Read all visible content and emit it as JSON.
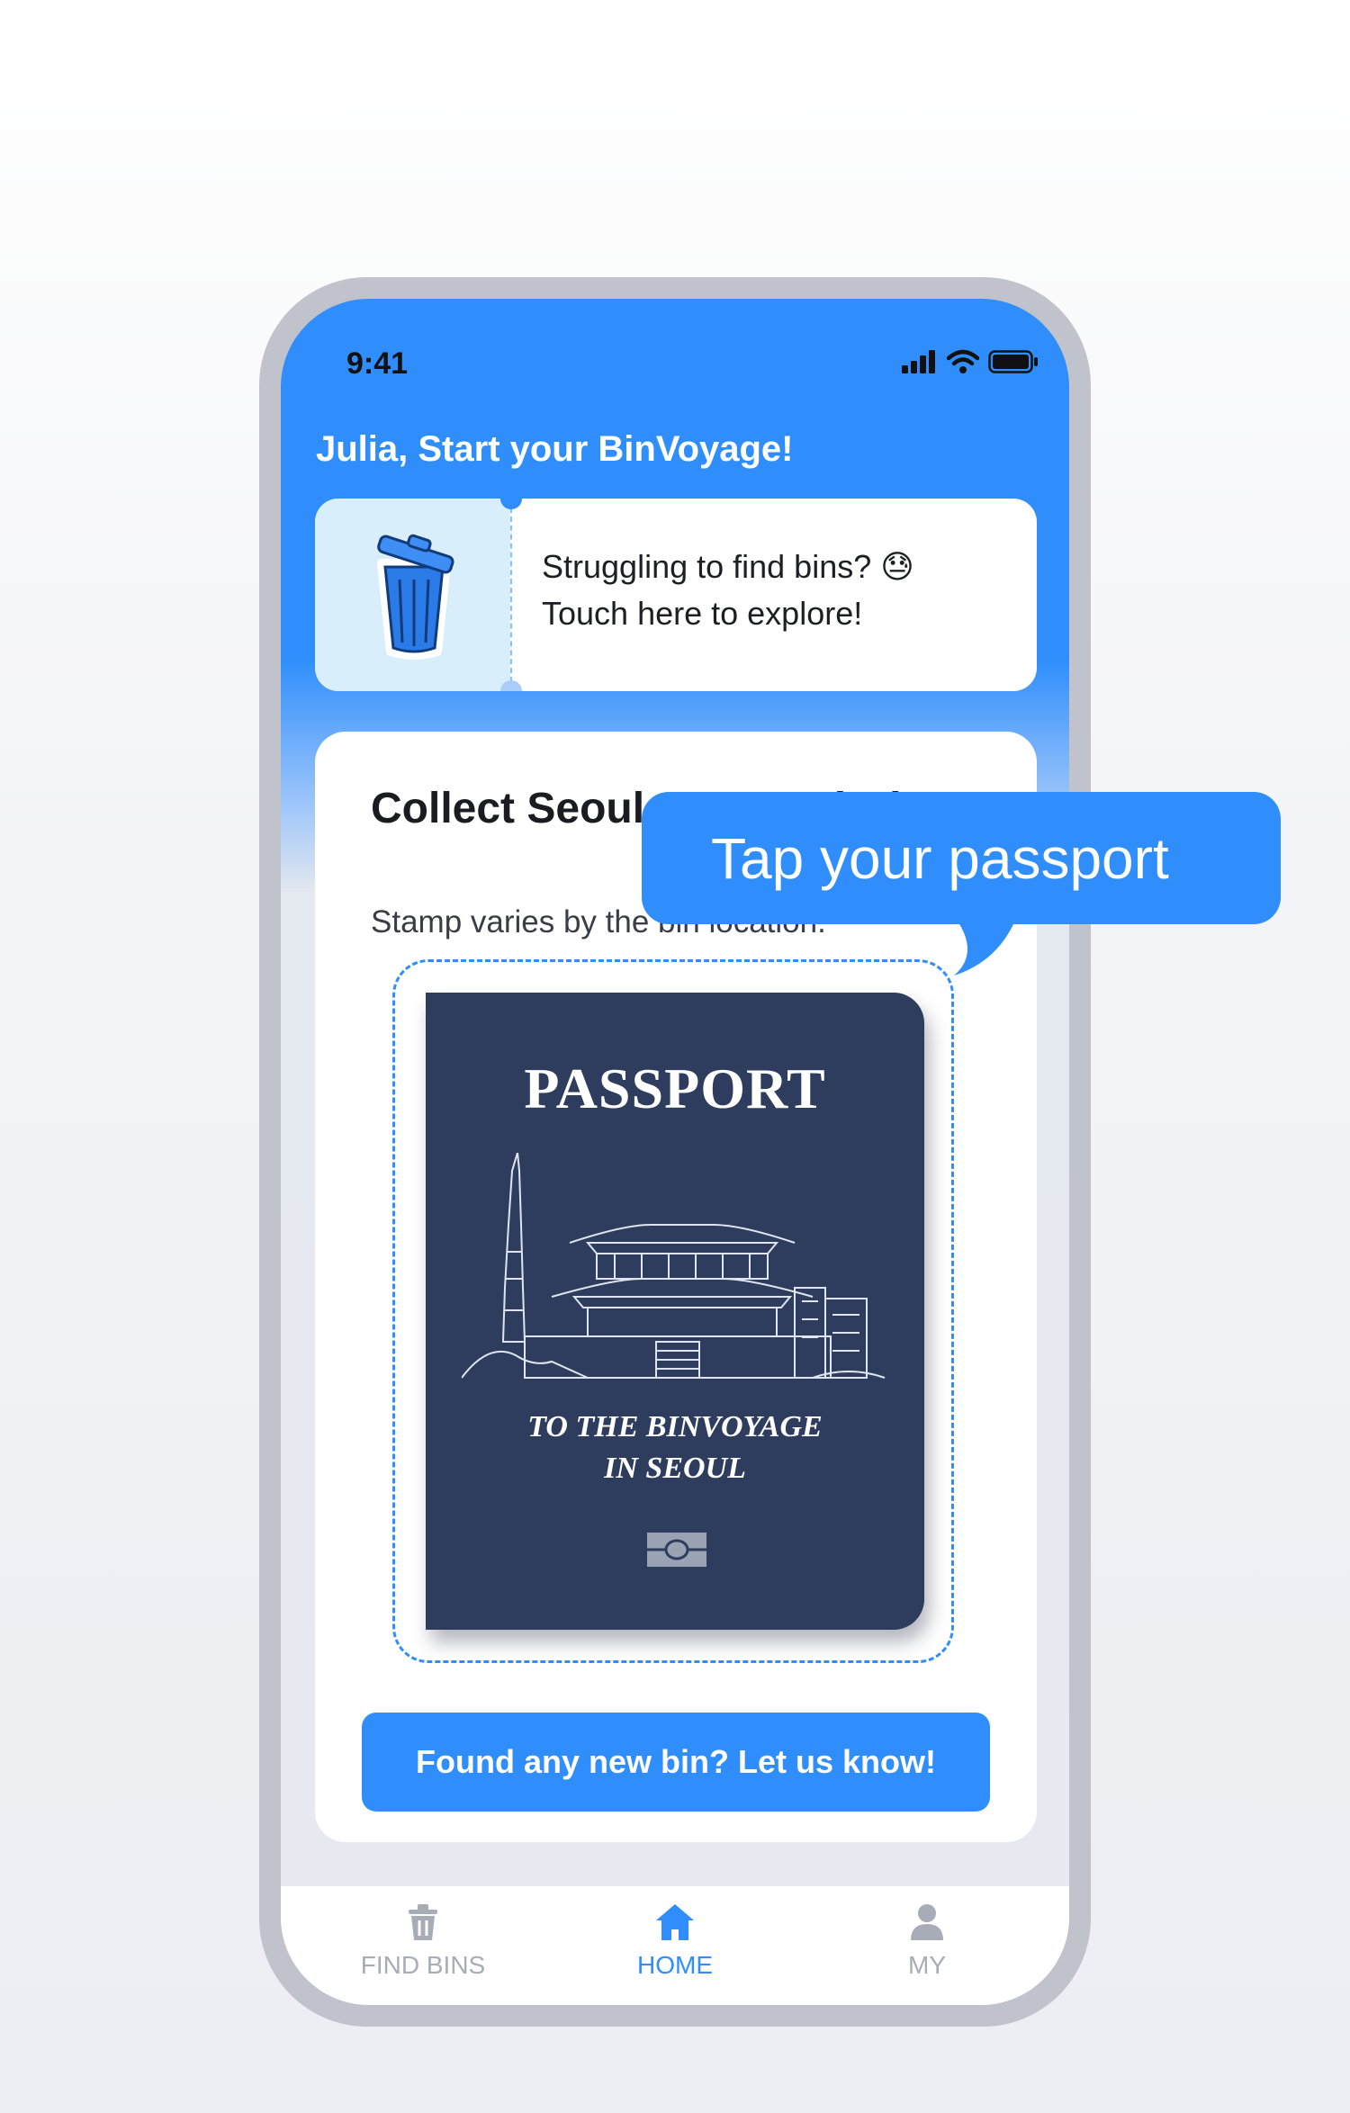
{
  "status_bar": {
    "time": "9:41"
  },
  "header": {
    "greeting": "Julia, Start your BinVoyage!"
  },
  "bins_card": {
    "line1": "Struggling to find bins? 😓",
    "line2": "Touch here to explore!",
    "icon": "trash-bin-icon"
  },
  "main_card": {
    "title": "Collect Seoul stamps during",
    "subtitle": "Stamp varies by the bin location.",
    "passport": {
      "title": "PASSPORT",
      "subtitle_line1": "TO THE BINVOYAGE",
      "subtitle_line2": "IN SEOUL"
    },
    "cta_label": "Found any new bin? Let us know!"
  },
  "tooltip": {
    "text": "Tap your passport"
  },
  "tabbar": {
    "items": [
      {
        "label": "FIND BINS",
        "icon": "trash-icon",
        "active": false
      },
      {
        "label": "HOME",
        "icon": "home-icon",
        "active": true
      },
      {
        "label": "MY",
        "icon": "user-icon",
        "active": false
      }
    ]
  },
  "colors": {
    "accent": "#2f8efc",
    "passport": "#2e3d5d",
    "inactive": "#a7acb6"
  }
}
